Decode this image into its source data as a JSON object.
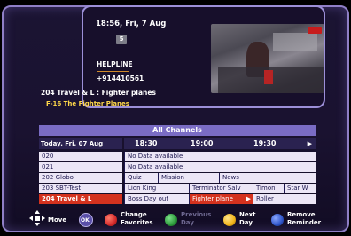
{
  "header": {
    "clock": "18:56, Fri, 7 Aug",
    "channel_number": "5",
    "helpline_label": "HELPLINE",
    "helpline_number": "+914410561"
  },
  "current_program": {
    "title": "204 Travel & L : Fighter planes",
    "subtitle": "F-16 The Fighter Planes"
  },
  "guide": {
    "title": "All Channels",
    "date": "Today, Fri, 07 Aug",
    "times": [
      "18:30",
      "19:00",
      "19:30"
    ],
    "rows": [
      {
        "channel": "020",
        "programs": [
          {
            "title": "No Data available"
          }
        ]
      },
      {
        "channel": "021",
        "programs": [
          {
            "title": "No Data available"
          }
        ]
      },
      {
        "channel": "202 Globo",
        "programs": [
          {
            "title": "Quiz"
          },
          {
            "title": "Mission"
          },
          {
            "title": "News"
          }
        ]
      },
      {
        "channel": "203 SBT-Test",
        "programs": [
          {
            "title": "Lion King"
          },
          {
            "title": "Terminator Salv"
          },
          {
            "title": "Timon"
          },
          {
            "title": "Star W"
          }
        ]
      },
      {
        "channel": "204 Travel & L",
        "programs": [
          {
            "title": "Boss Day out"
          },
          {
            "title": "Fighter plane"
          },
          {
            "title": "Roller"
          }
        ]
      }
    ]
  },
  "footer": {
    "move_label": "Move",
    "ok_label": "OK",
    "red_label": "Change Favorites",
    "green_label": "Previous Day",
    "yellow_label": "Next Day",
    "blue_label": "Remove Reminder",
    "red_line1": "Change",
    "red_line2": "Favorites",
    "green_line1": "Previous",
    "green_line2": "Day",
    "yellow_line1": "Next",
    "yellow_line2": "Day",
    "blue_line1": "Remove",
    "blue_line2": "Reminder"
  },
  "colors": {
    "accent": "#7a6cc4",
    "selected": "#d4321e",
    "red_button": "#d42a2a",
    "green_button": "#2c9a3a",
    "yellow_button": "#f0b418",
    "blue_button": "#2f55c8"
  }
}
